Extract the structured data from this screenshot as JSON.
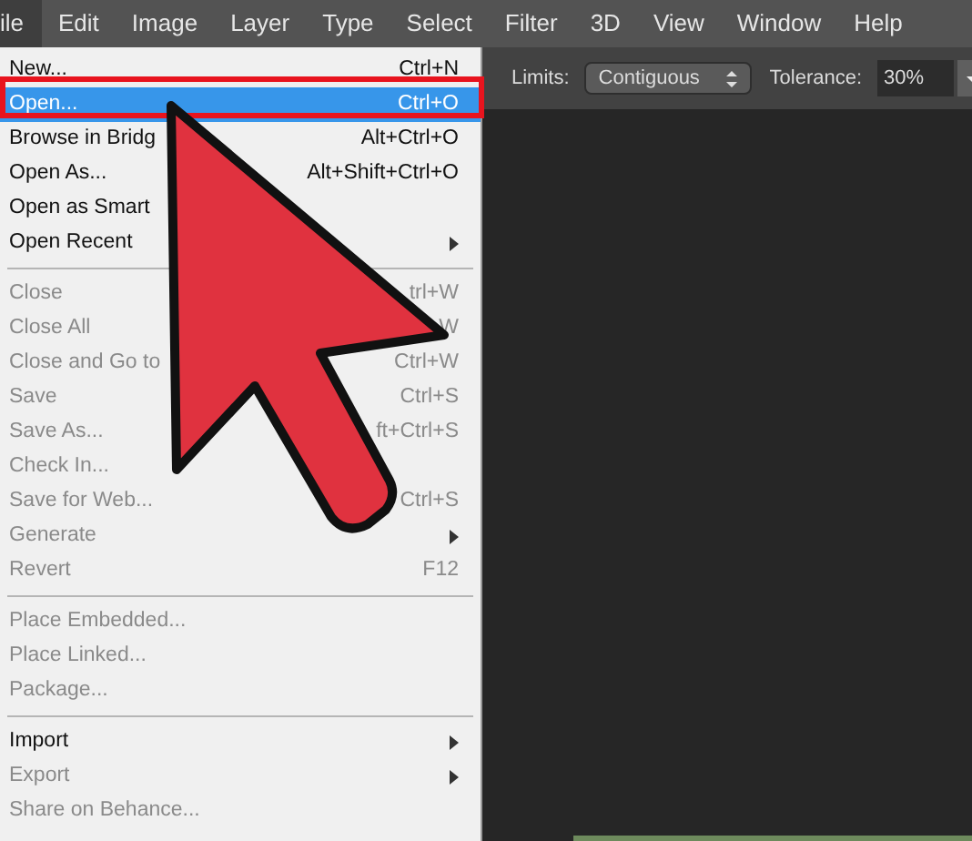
{
  "menu_bar": [
    {
      "label": "ile",
      "selected": true
    },
    {
      "label": "Edit",
      "selected": false
    },
    {
      "label": "Image",
      "selected": false
    },
    {
      "label": "Layer",
      "selected": false
    },
    {
      "label": "Type",
      "selected": false
    },
    {
      "label": "Select",
      "selected": false
    },
    {
      "label": "Filter",
      "selected": false
    },
    {
      "label": "3D",
      "selected": false
    },
    {
      "label": "View",
      "selected": false
    },
    {
      "label": "Window",
      "selected": false
    },
    {
      "label": "Help",
      "selected": false
    }
  ],
  "file_menu": [
    {
      "kind": "item",
      "label": "New...",
      "shortcut": "Ctrl+N",
      "disabled": false,
      "selected": false,
      "submenu": false
    },
    {
      "kind": "item",
      "label": "Open...",
      "shortcut": "Ctrl+O",
      "disabled": false,
      "selected": true,
      "submenu": false
    },
    {
      "kind": "item",
      "label": "Browse in Bridg",
      "shortcut": "Alt+Ctrl+O",
      "disabled": false,
      "selected": false,
      "submenu": false
    },
    {
      "kind": "item",
      "label": "Open As...",
      "shortcut": "Alt+Shift+Ctrl+O",
      "disabled": false,
      "selected": false,
      "submenu": false
    },
    {
      "kind": "item",
      "label": "Open as Smart",
      "disabled": false,
      "selected": false,
      "submenu": false
    },
    {
      "kind": "item",
      "label": "Open Recent",
      "disabled": false,
      "selected": false,
      "submenu": true
    },
    {
      "kind": "separator"
    },
    {
      "kind": "item",
      "label": "Close",
      "shortcut": "trl+W",
      "disabled": true,
      "selected": false,
      "submenu": false
    },
    {
      "kind": "item",
      "label": "Close All",
      "shortcut": "W",
      "disabled": true,
      "selected": false,
      "submenu": false
    },
    {
      "kind": "item",
      "label": "Close and Go to",
      "shortcut": "Ctrl+W",
      "disabled": true,
      "selected": false,
      "submenu": false
    },
    {
      "kind": "item",
      "label": "Save",
      "shortcut": "Ctrl+S",
      "disabled": true,
      "selected": false,
      "submenu": false
    },
    {
      "kind": "item",
      "label": "Save As...",
      "shortcut": "ft+Ctrl+S",
      "disabled": true,
      "selected": false,
      "submenu": false
    },
    {
      "kind": "item",
      "label": "Check In...",
      "disabled": true,
      "selected": false,
      "submenu": false
    },
    {
      "kind": "item",
      "label": "Save for Web...",
      "shortcut": "Ctrl+S",
      "disabled": true,
      "selected": false,
      "submenu": false
    },
    {
      "kind": "item",
      "label": "Generate",
      "disabled": true,
      "selected": false,
      "submenu": true
    },
    {
      "kind": "item",
      "label": "Revert",
      "shortcut": "F12",
      "disabled": true,
      "selected": false,
      "submenu": false
    },
    {
      "kind": "separator"
    },
    {
      "kind": "item",
      "label": "Place Embedded...",
      "disabled": true,
      "selected": false,
      "submenu": false
    },
    {
      "kind": "item",
      "label": "Place Linked...",
      "disabled": true,
      "selected": false,
      "submenu": false
    },
    {
      "kind": "item",
      "label": "Package...",
      "disabled": true,
      "selected": false,
      "submenu": false
    },
    {
      "kind": "separator"
    },
    {
      "kind": "item",
      "label": "Import",
      "disabled": false,
      "selected": false,
      "submenu": true
    },
    {
      "kind": "item",
      "label": "Export",
      "disabled": true,
      "selected": false,
      "submenu": true
    },
    {
      "kind": "item",
      "label": "Share on Behance...",
      "disabled": true,
      "selected": false,
      "submenu": false
    }
  ],
  "options_bar": {
    "limits_label": "Limits:",
    "limits_value": "Contiguous",
    "tolerance_label": "Tolerance:",
    "tolerance_value": "30%"
  }
}
